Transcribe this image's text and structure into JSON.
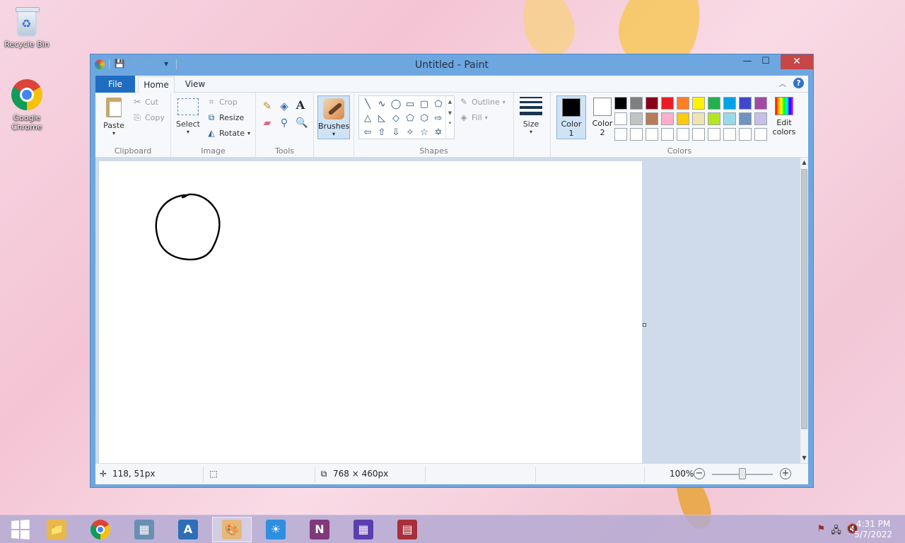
{
  "desktop": {
    "icons": [
      {
        "label": "Recycle Bin",
        "icon": "recycle-bin-icon"
      },
      {
        "label": "Google Chrome",
        "icon": "chrome-icon"
      }
    ]
  },
  "window": {
    "title": "Untitled - Paint",
    "qat": {
      "save_icon": "💾",
      "undo_icon": "↶",
      "redo_icon": "↷",
      "dropdown_icon": "▾"
    },
    "controls": {
      "minimize": "—",
      "maximize": "☐",
      "close": "✕"
    }
  },
  "tabs": {
    "file": "File",
    "home": "Home",
    "view": "View",
    "collapse_icon": "︿",
    "help": "?"
  },
  "ribbon": {
    "clipboard": {
      "group": "Clipboard",
      "paste": "Paste",
      "cut": "Cut",
      "copy": "Copy"
    },
    "image": {
      "group": "Image",
      "select": "Select",
      "crop": "Crop",
      "resize": "Resize",
      "rotate": "Rotate"
    },
    "tools": {
      "group": "Tools",
      "text_tool": "A"
    },
    "brushes": {
      "label": "Brushes"
    },
    "shapes": {
      "group": "Shapes",
      "outline": "Outline",
      "fill": "Fill",
      "glyphs": [
        "╲",
        "∿",
        "◯",
        "▭",
        "▢",
        "⬠",
        "△",
        "◺",
        "◇",
        "⬠",
        "⬡",
        "⇨",
        "⇦",
        "⇧",
        "⇩",
        "✧",
        "☆",
        "✡"
      ]
    },
    "size": {
      "label": "Size"
    },
    "colors": {
      "group": "Colors",
      "color1": "Color 1",
      "color2": "Color 2",
      "edit": "Edit colors",
      "color1_value": "#000000",
      "color2_value": "#ffffff",
      "palette": [
        "#000000",
        "#7f7f7f",
        "#880015",
        "#ed1c24",
        "#ff7f27",
        "#fff200",
        "#22b14c",
        "#00a2e8",
        "#3f48cc",
        "#a349a4",
        "#ffffff",
        "#c3c3c3",
        "#b97a57",
        "#ffaec9",
        "#ffc90e",
        "#efe4b0",
        "#b5e61d",
        "#99d9ea",
        "#7092be",
        "#c8bfe7",
        "#ffffff",
        "#ffffff",
        "#ffffff",
        "#ffffff",
        "#ffffff",
        "#ffffff",
        "#ffffff",
        "#ffffff",
        "#ffffff",
        "#ffffff"
      ]
    }
  },
  "status": {
    "cursor_pos": "118, 51px",
    "canvas_size": "768 × 460px",
    "zoom": "100%",
    "zoom_level": 0.5
  },
  "taskbar": {
    "apps": [
      {
        "name": "file-explorer",
        "glyph": "📁",
        "color": "#e8b84a"
      },
      {
        "name": "chrome",
        "glyph": "",
        "color": "#ffffff"
      },
      {
        "name": "calculator",
        "glyph": "▦",
        "color": "#6a8fb5"
      },
      {
        "name": "wordpad",
        "glyph": "A",
        "color": "#2d6fb7"
      },
      {
        "name": "paint",
        "glyph": "🎨",
        "color": "#e6b97a"
      },
      {
        "name": "weather",
        "glyph": "☀",
        "color": "#2f8ee0"
      },
      {
        "name": "onenote",
        "glyph": "N",
        "color": "#80397b"
      },
      {
        "name": "calendar",
        "glyph": "▦",
        "color": "#5a3fb0"
      },
      {
        "name": "news",
        "glyph": "▤",
        "color": "#a82f3b"
      }
    ],
    "time": "4:31 PM",
    "date": "5/7/2022"
  }
}
